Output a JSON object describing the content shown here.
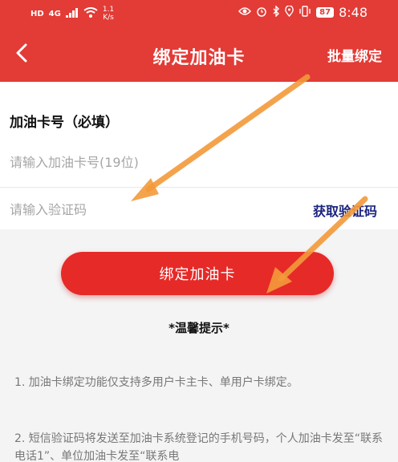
{
  "status_bar": {
    "network_badge": "HD",
    "signal_badge": "4G",
    "speed_value": "1.1",
    "speed_unit": "K/s",
    "battery": "87",
    "time": "8:48"
  },
  "nav": {
    "title": "绑定加油卡",
    "action": "批量绑定"
  },
  "form": {
    "card_label": "加油卡号（必填）",
    "card_placeholder": "请输入加油卡号(19位)",
    "code_placeholder": "请输入验证码",
    "get_code": "获取验证码"
  },
  "bind_button": "绑定加油卡",
  "tips": {
    "title": "*温馨提示*",
    "items": [
      "1. 加油卡绑定功能仅支持多用户卡主卡、单用户卡绑定。",
      "2. 短信验证码将发送至加油卡系统登记的手机号码，个人加油卡发至“联系电话1”、单位加油卡发至“联系电"
    ]
  },
  "colors": {
    "brand_red": "#e33b36",
    "button_red": "#e62a28",
    "link_blue": "#1a237e",
    "annotation_orange": "#f39a3a"
  }
}
